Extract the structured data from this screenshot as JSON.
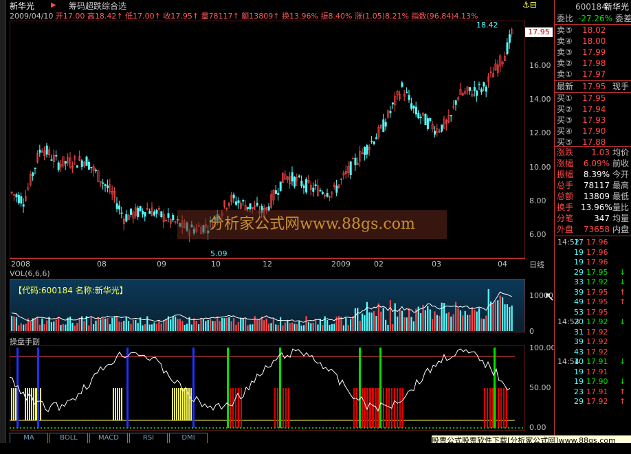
{
  "header": {
    "stock_name": "新华光",
    "formula_name": "筹码超跌综合选",
    "date": "2009/04/10",
    "open_label": "开",
    "open": "17.00",
    "high_label": "高",
    "high": "18.42",
    "low_label": "低",
    "low": "17.00",
    "close_label": "收",
    "close": "17.95",
    "vol_label": "量",
    "vol": "78117",
    "amt_label": "额",
    "amt": "13809",
    "turn_label": "换",
    "turn": "13.96%",
    "amp_label": "振",
    "amp": "8.40%",
    "chg_label": "涨",
    "chg": "(1.05)8.21%",
    "index_label": "指数",
    "index": "(96.84)4.13%",
    "peak_label": "18.42",
    "low_mark_label": "5.09"
  },
  "price_axis": [
    "16.00",
    "14.00",
    "12.00",
    "10.00",
    "8.00",
    "6.00"
  ],
  "price_tag": "17.95",
  "date_ticks": [
    "2008",
    "08",
    "09",
    "10",
    "12",
    "2009",
    "02",
    "03",
    "04"
  ],
  "period_label": "日线",
  "vol_panel": {
    "label": "VOL(6,6,6)",
    "code_text": "【代码:600184 名称:新华光】",
    "axis_top": "10000",
    "axis_zero": "0"
  },
  "ind_panel": {
    "label": "操盘手副",
    "axis": [
      "100.00",
      "50.00",
      "0.00"
    ]
  },
  "tabs": [
    "MA",
    "BOLL",
    "MACD",
    "RSI",
    "DMI"
  ],
  "watermark": "分析家公式网www.88gs.com",
  "banner": "股票公式股票软件下载[分析家公式网]www.88gs.com",
  "right_panel": {
    "code": "600184",
    "name": "新华光",
    "ratio_label": "委比",
    "ratio": "-27.26%",
    "ratio_diff": "委差",
    "sells": [
      {
        "label": "卖⑤",
        "price": "18.02"
      },
      {
        "label": "卖④",
        "price": "18.00"
      },
      {
        "label": "卖③",
        "price": "17.99"
      },
      {
        "label": "卖②",
        "price": "17.98"
      },
      {
        "label": "卖①",
        "price": "17.97"
      }
    ],
    "last_label": "最新",
    "last": "17.95",
    "last_ex": "现手",
    "buys": [
      {
        "label": "买①",
        "price": "17.95"
      },
      {
        "label": "买②",
        "price": "17.94"
      },
      {
        "label": "买③",
        "price": "17.93"
      },
      {
        "label": "买④",
        "price": "17.90"
      },
      {
        "label": "买⑤",
        "price": "17.88"
      }
    ],
    "stats": [
      {
        "label": "涨跌",
        "value": "1.03",
        "ex": "均价"
      },
      {
        "label": "涨幅",
        "value": "6.09%",
        "ex": "前收"
      },
      {
        "label": "振幅",
        "value": "8.39%",
        "ex": "今开"
      },
      {
        "label": "总手",
        "value": "78117",
        "ex": "最高"
      },
      {
        "label": "总额",
        "value": "13809",
        "ex": "最低"
      },
      {
        "label": "换手",
        "value": "13.96%",
        "ex": "量比"
      },
      {
        "label": "分笔",
        "value": "347",
        "ex": "均量"
      },
      {
        "label": "外盘",
        "value": "73658",
        "ex": "内盘"
      }
    ],
    "ticks": [
      {
        "time": "14:52",
        "vol": "17",
        "price": "17.96",
        "arrow": ""
      },
      {
        "time": "",
        "vol": "19",
        "price": "17.96",
        "arrow": ""
      },
      {
        "time": "",
        "vol": "19",
        "price": "17.96",
        "arrow": ""
      },
      {
        "time": "",
        "vol": "29",
        "price": "17.95",
        "arrow": "↓"
      },
      {
        "time": "",
        "vol": "33",
        "price": "17.92",
        "arrow": "↓"
      },
      {
        "time": "",
        "vol": "39",
        "price": "17.95",
        "arrow": "↑"
      },
      {
        "time": "",
        "vol": "49",
        "price": "17.95",
        "arrow": "↑"
      },
      {
        "time": "",
        "vol": "53",
        "price": "17.95",
        "arrow": ""
      },
      {
        "time": "14:53",
        "vol": "20",
        "price": "17.92",
        "arrow": "↓"
      },
      {
        "time": "",
        "vol": "31",
        "price": "17.92",
        "arrow": ""
      },
      {
        "time": "",
        "vol": "39",
        "price": "17.92",
        "arrow": ""
      },
      {
        "time": "",
        "vol": "43",
        "price": "17.92",
        "arrow": ""
      },
      {
        "time": "14:54",
        "vol": "10",
        "price": "17.91",
        "arrow": "↓"
      },
      {
        "time": "",
        "vol": "19",
        "price": "17.91",
        "arrow": ""
      },
      {
        "time": "",
        "vol": "19",
        "price": "17.90",
        "arrow": "↓"
      },
      {
        "time": "",
        "vol": "23",
        "price": "17.91",
        "arrow": "↑"
      },
      {
        "time": "",
        "vol": "29",
        "price": "17.92",
        "arrow": "↑"
      }
    ]
  },
  "colors": {
    "up": "#ff4848",
    "down": "#54ffff",
    "accent": "#c03030"
  }
}
